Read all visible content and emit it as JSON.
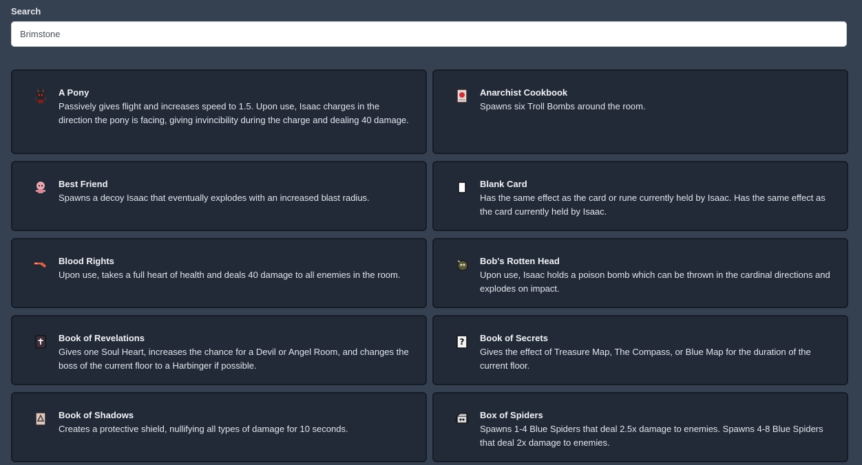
{
  "search": {
    "label": "Search",
    "value": "Brimstone"
  },
  "items": [
    {
      "name": "A Pony",
      "description": "Passively gives flight and increases speed to 1.5. Upon use, Isaac charges in the direction the pony is facing, giving invincibility during the charge and dealing 40 damage.",
      "icon": "pony-icon"
    },
    {
      "name": "Anarchist Cookbook",
      "description": "Spawns six Troll Bombs around the room.",
      "icon": "cookbook-icon"
    },
    {
      "name": "Best Friend",
      "description": "Spawns a decoy Isaac that eventually explodes with an increased blast radius.",
      "icon": "best-friend-icon"
    },
    {
      "name": "Blank Card",
      "description": "Has the same effect as the card or rune currently held by Isaac. Has the same effect as the card currently held by Isaac.",
      "icon": "blank-card-icon"
    },
    {
      "name": "Blood Rights",
      "description": "Upon use, takes a full heart of health and deals 40 damage to all enemies in the room.",
      "icon": "blood-rights-icon"
    },
    {
      "name": "Bob's Rotten Head",
      "description": "Upon use, Isaac holds a poison bomb which can be thrown in the cardinal directions and explodes on impact.",
      "icon": "rotten-head-icon"
    },
    {
      "name": "Book of Revelations",
      "description": "Gives one Soul Heart, increases the chance for a Devil or Angel Room, and changes the boss of the current floor to a Harbinger if possible.",
      "icon": "book-revelations-icon"
    },
    {
      "name": "Book of Secrets",
      "description": "Gives the effect of Treasure Map, The Compass, or Blue Map for the duration of the current floor.",
      "icon": "book-secrets-icon"
    },
    {
      "name": "Book of Shadows",
      "description": "Creates a protective shield, nullifying all types of damage for 10 seconds.",
      "icon": "book-shadows-icon"
    },
    {
      "name": "Box of Spiders",
      "description": "Spawns 1-4 Blue Spiders that deal 2.5x damage to enemies. Spawns 4-8 Blue Spiders that deal 2x damage to enemies.",
      "icon": "spider-box-icon"
    }
  ]
}
